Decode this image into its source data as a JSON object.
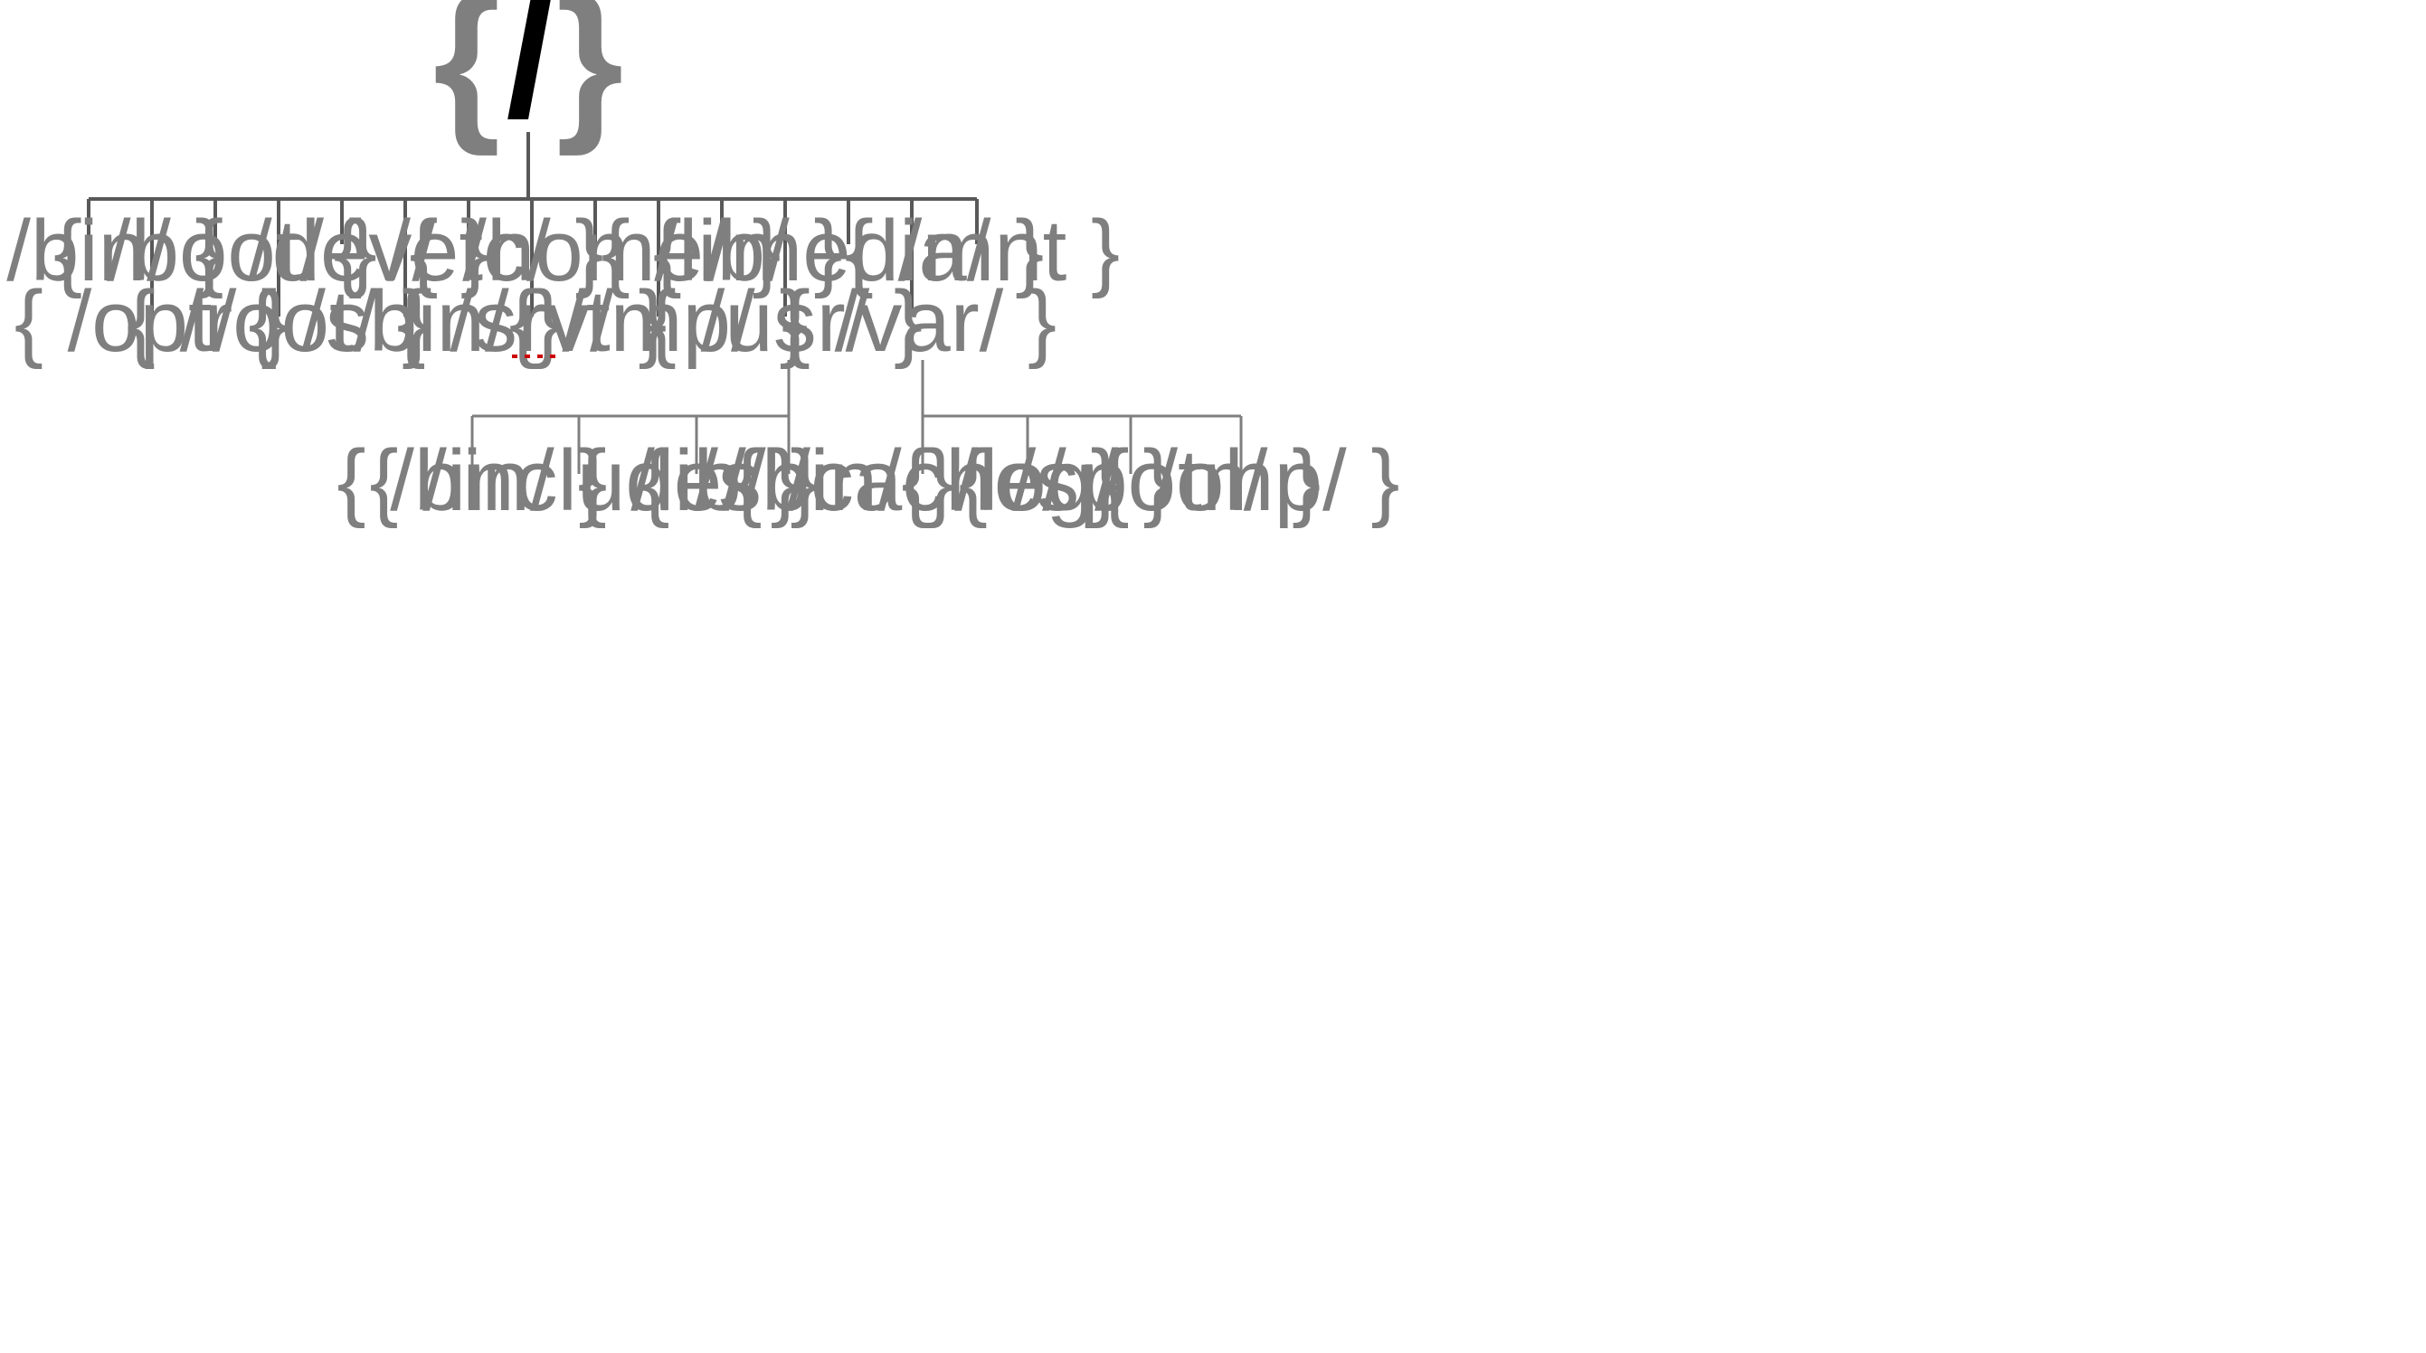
{
  "root": {
    "brace_l": "{",
    "label": "/",
    "brace_r": "}"
  },
  "row1": [
    "{  /bin/  }",
    "{  /boot/  }",
    "{  /dev/  }",
    "{  /etc/  }",
    "{  /home/  }",
    "{  /lib/  }",
    "{  /media/  }",
    "{  /mnt  }"
  ],
  "row2": [
    "{  /opt/  }",
    "{  /root/  }",
    "{  /sbin/  }",
    "{  /srv/  }",
    "{  /tmp/  }",
    "{  /usr/  }",
    "{  /var/  }"
  ],
  "usr_children": [
    "{  /bin/  }",
    "{  /include/  }",
    "{  /lib/  }",
    "{  /sbin/  }"
  ],
  "var_children": [
    "{  /cache/  }",
    "{  /log/  }",
    "{  /spool/  }",
    "{  /tmp/  }"
  ]
}
